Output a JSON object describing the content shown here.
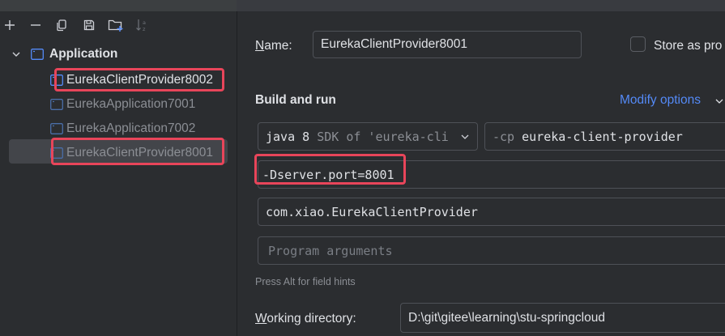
{
  "toolbar": {
    "add_icon": "plus-icon",
    "remove_icon": "minus-icon",
    "copy_icon": "copy-icon",
    "save_icon": "save-icon",
    "folder_icon": "new-folder-icon",
    "sort_icon": "sort-alpha-icon"
  },
  "tree": {
    "group_label": "Application",
    "items": [
      {
        "label": "EurekaClientProvider8002"
      },
      {
        "label": "EurekaApplication7001"
      },
      {
        "label": "EurekaApplication7002"
      },
      {
        "label": "EurekaClientProvider8001"
      }
    ]
  },
  "form": {
    "name_label_first": "N",
    "name_label_rest": "ame:",
    "name_value": "EurekaClientProvider8001",
    "store_label": "Store as pro",
    "section_title": "Build and run",
    "modify_options": "Modify options",
    "jdk_main": "java 8",
    "jdk_detail": "SDK of 'eureka-cli",
    "cp_flag": "-cp",
    "cp_module": "eureka-client-provider",
    "vm_options": "-Dserver.port=8001",
    "main_class": "com.xiao.EurekaClientProvider",
    "program_args_placeholder": "Program arguments",
    "hint": "Press Alt for field hints",
    "workdir_label_first": "W",
    "workdir_label_rest": "orking directory:",
    "workdir_value": "D:\\git\\gitee\\learning\\stu-springcloud"
  },
  "colors": {
    "highlight": "#e8455a",
    "link": "#548af7",
    "background": "#2b2d30"
  }
}
